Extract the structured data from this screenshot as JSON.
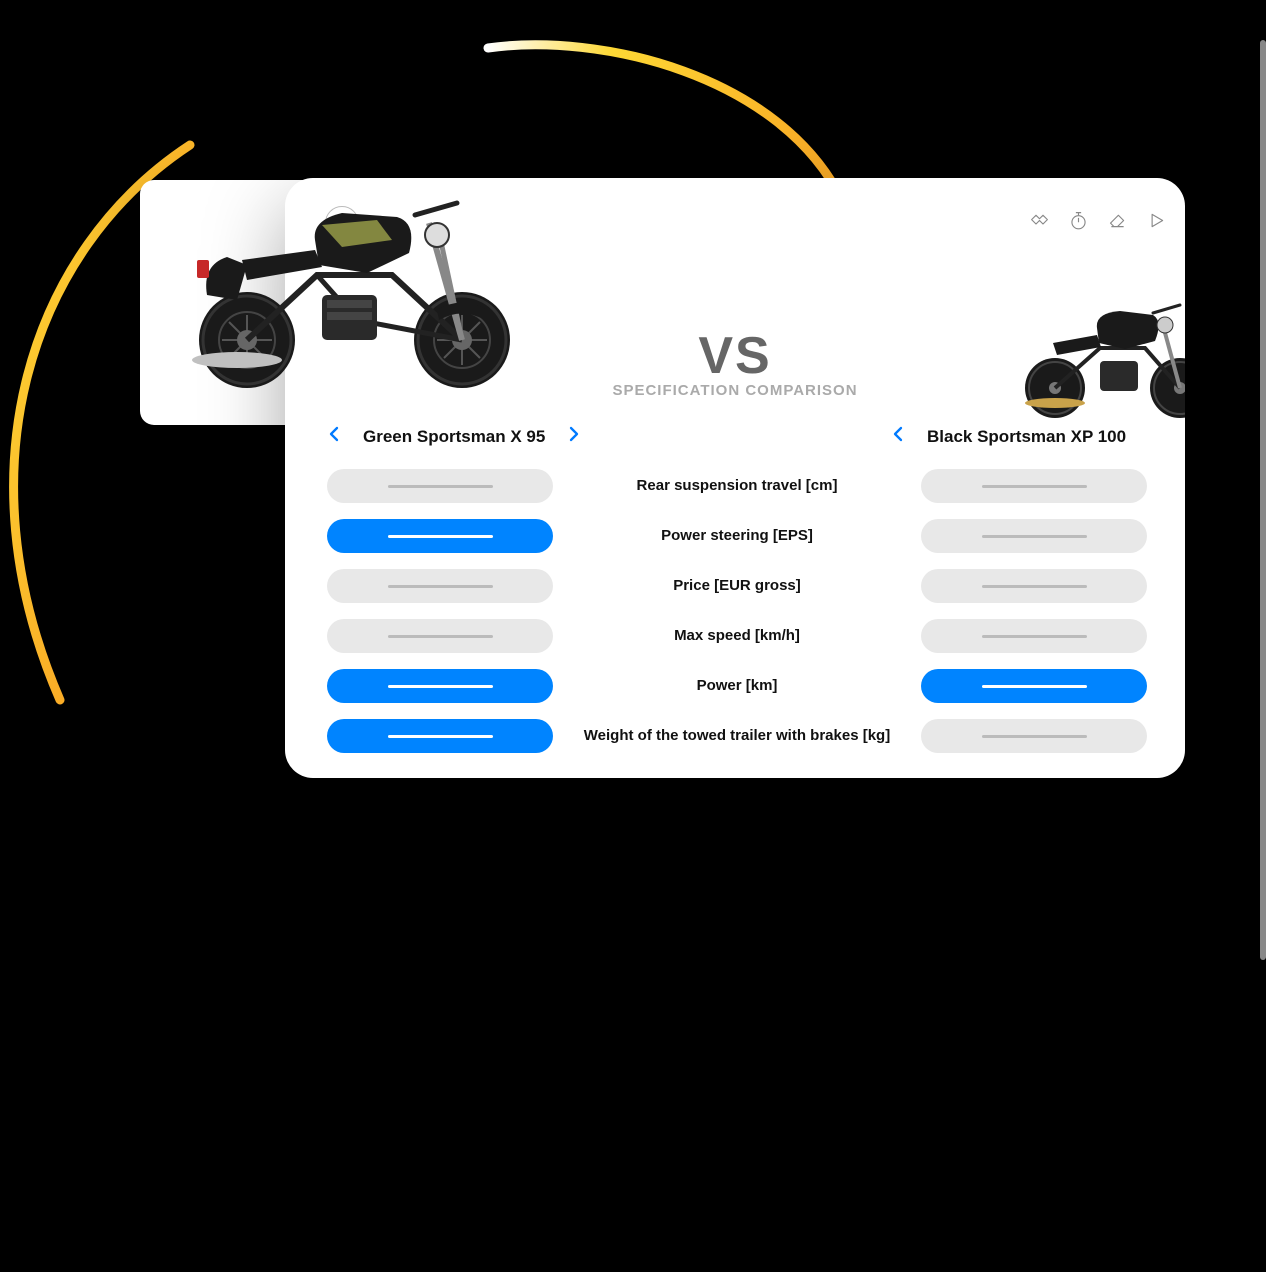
{
  "comparison": {
    "vs_label": "VS",
    "subtitle": "SPECIFICATION COMPARISON",
    "products": {
      "left": {
        "name": "Green Sportsman X 95"
      },
      "right": {
        "name": "Black Sportsman XP 100"
      }
    },
    "specs": [
      {
        "label": "Rear suspension travel [cm]",
        "left_highlight": false,
        "right_highlight": false
      },
      {
        "label": "Power steering [EPS]",
        "left_highlight": true,
        "right_highlight": false
      },
      {
        "label": "Price [EUR gross]",
        "left_highlight": false,
        "right_highlight": false
      },
      {
        "label": "Max speed [km/h]",
        "left_highlight": false,
        "right_highlight": false
      },
      {
        "label": "Power [km]",
        "left_highlight": true,
        "right_highlight": true
      },
      {
        "label": "Weight of the towed trailer with brakes [kg]",
        "left_highlight": true,
        "right_highlight": false
      }
    ]
  },
  "colors": {
    "accent": "#0084ff",
    "chevron": "#007aff"
  }
}
